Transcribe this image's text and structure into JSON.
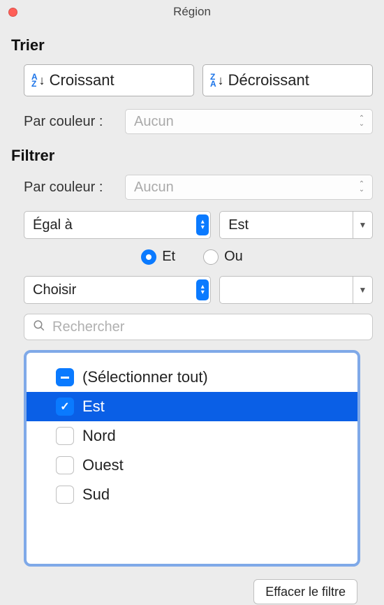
{
  "window": {
    "title": "Région"
  },
  "sort": {
    "heading": "Trier",
    "asc_label": "Croissant",
    "desc_label": "Décroissant",
    "by_color_label": "Par couleur :",
    "by_color_value": "Aucun"
  },
  "filter": {
    "heading": "Filtrer",
    "by_color_label": "Par couleur :",
    "by_color_value": "Aucun",
    "condition1": {
      "operator": "Égal à",
      "value": "Est"
    },
    "logic": {
      "and_label": "Et",
      "or_label": "Ou",
      "selected": "and"
    },
    "condition2": {
      "operator": "Choisir",
      "value": ""
    },
    "search_placeholder": "Rechercher",
    "items": [
      {
        "label": "(Sélectionner tout)",
        "state": "indeterminate",
        "selected": false
      },
      {
        "label": "Est",
        "state": "checked",
        "selected": true
      },
      {
        "label": "Nord",
        "state": "unchecked",
        "selected": false
      },
      {
        "label": "Ouest",
        "state": "unchecked",
        "selected": false
      },
      {
        "label": "Sud",
        "state": "unchecked",
        "selected": false
      }
    ],
    "clear_label": "Effacer le filtre"
  }
}
